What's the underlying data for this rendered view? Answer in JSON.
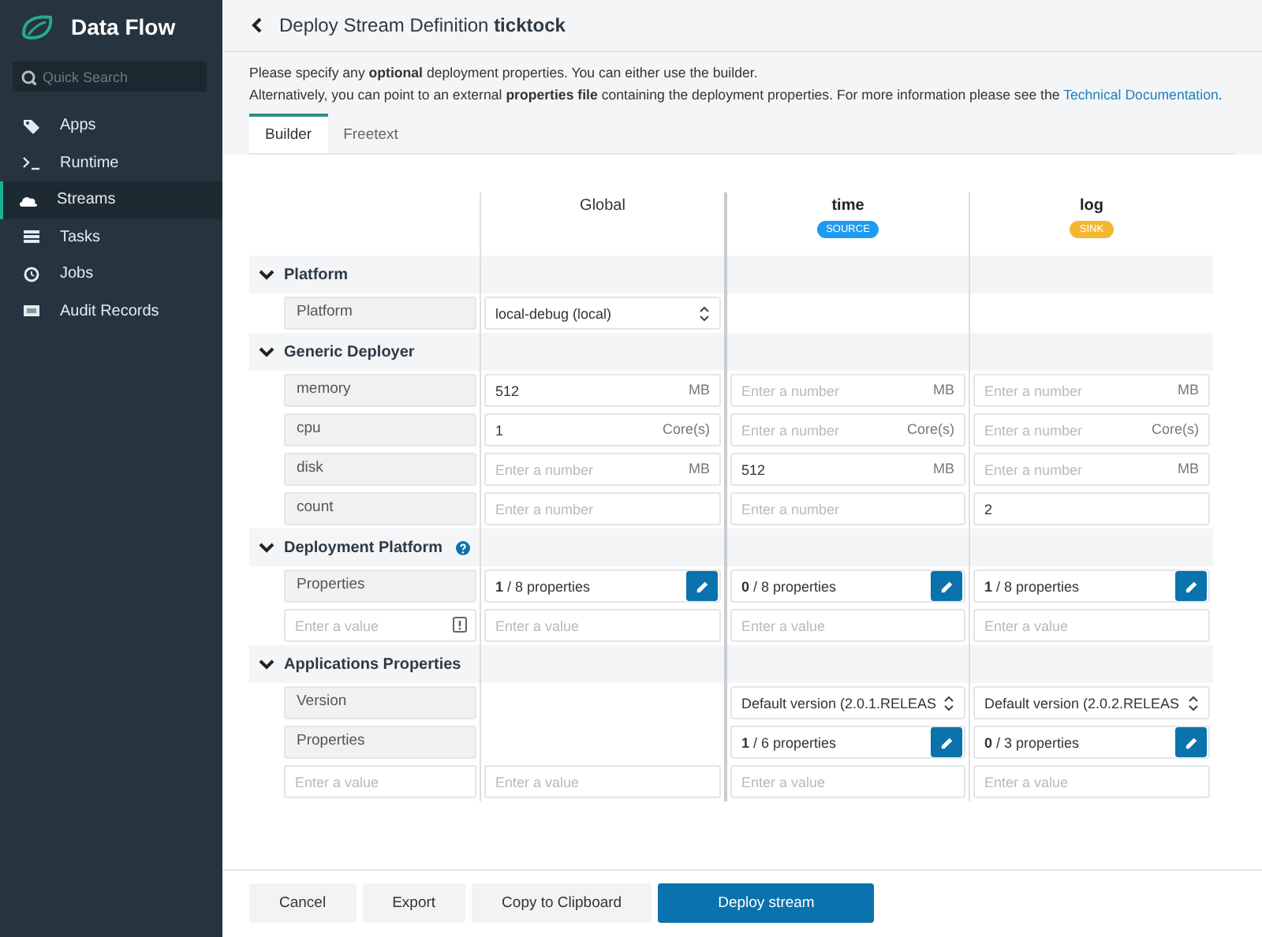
{
  "sidebar": {
    "title": "Data Flow",
    "search": {
      "placeholder": "Quick Search"
    },
    "items": [
      {
        "label": "Apps",
        "selected": false
      },
      {
        "label": "Runtime",
        "selected": false
      },
      {
        "label": "Streams",
        "selected": true
      },
      {
        "label": "Tasks",
        "selected": false
      },
      {
        "label": "Jobs",
        "selected": false
      },
      {
        "label": "Audit Records",
        "selected": false
      }
    ]
  },
  "header": {
    "title": "Deploy Stream Definition **ticktock**"
  },
  "intro": {
    "line_1": "Please specify any **optional** deployment properties. You can either use the builder.",
    "line_2": "Alternatively, you can point to an external **properties file** containing the deployment properties. For more information please see the ",
    "link": "Technical Documentation",
    "line_2_end": "."
  },
  "tabs": [
    {
      "label": "Builder",
      "selected": true
    },
    {
      "label": "Freetext",
      "selected": false
    }
  ],
  "table": {
    "columns": [
      {
        "name": "Global",
        "kind": "global"
      },
      {
        "name": "time",
        "kind": "app",
        "badge": "SOURCE",
        "color": "#1e9bf0"
      },
      {
        "name": "log",
        "kind": "app",
        "badge": "SINK",
        "color": "#f5b731"
      }
    ],
    "sections": [
      {
        "title": "Platform",
        "expanded": true,
        "help": false,
        "rows": [
          {
            "label": "Platform",
            "cells": [
              {
                "kind": "select",
                "value": "local-debug (local)"
              },
              {
                "kind": "blank"
              },
              {
                "kind": "blank"
              }
            ]
          }
        ]
      },
      {
        "title": "Generic Deployer",
        "expanded": true,
        "help": false,
        "rows": [
          {
            "label": "memory",
            "cells": [
              {
                "kind": "number",
                "value": "512",
                "unit": "MB"
              },
              {
                "kind": "number",
                "placeholder": "Enter a number",
                "unit": "MB"
              },
              {
                "kind": "number",
                "placeholder": "Enter a number",
                "unit": "MB"
              }
            ]
          },
          {
            "label": "cpu",
            "cells": [
              {
                "kind": "number",
                "value": "1",
                "unit": "Core(s)"
              },
              {
                "kind": "number",
                "placeholder": "Enter a number",
                "unit": "Core(s)"
              },
              {
                "kind": "number",
                "placeholder": "Enter a number",
                "unit": "Core(s)"
              }
            ]
          },
          {
            "label": "disk",
            "cells": [
              {
                "kind": "number",
                "placeholder": "Enter a number",
                "unit": "MB"
              },
              {
                "kind": "number",
                "value": "512",
                "unit": "MB"
              },
              {
                "kind": "number",
                "placeholder": "Enter a number",
                "unit": "MB"
              }
            ]
          },
          {
            "label": "count",
            "cells": [
              {
                "kind": "number",
                "placeholder": "Enter a number"
              },
              {
                "kind": "number",
                "placeholder": "Enter a number"
              },
              {
                "kind": "number",
                "value": "2"
              }
            ]
          }
        ]
      },
      {
        "title": "Deployment Platform",
        "expanded": true,
        "help": true,
        "rows": [
          {
            "label": "Properties",
            "cells": [
              {
                "kind": "properties",
                "text": "**1** / 8 properties"
              },
              {
                "kind": "properties",
                "text": "**0** / 8 properties"
              },
              {
                "kind": "properties",
                "text": "**1** / 8 properties"
              }
            ]
          },
          {
            "label_field": {
              "placeholder": "Enter a value",
              "invalid": true
            },
            "cells": [
              {
                "kind": "text",
                "placeholder": "Enter a value"
              },
              {
                "kind": "text",
                "placeholder": "Enter a value"
              },
              {
                "kind": "text",
                "placeholder": "Enter a value"
              }
            ]
          }
        ]
      },
      {
        "title": "Applications Properties",
        "expanded": true,
        "help": false,
        "rows": [
          {
            "label": "Version",
            "cells": [
              {
                "kind": "blank"
              },
              {
                "kind": "select",
                "value": "Default version (2.0.1.RELEAS"
              },
              {
                "kind": "select",
                "value": "Default version (2.0.2.RELEAS"
              }
            ]
          },
          {
            "label": "Properties",
            "cells": [
              {
                "kind": "blank"
              },
              {
                "kind": "properties",
                "text": "**1** / 6 properties"
              },
              {
                "kind": "properties",
                "text": "**0** / 3 properties"
              }
            ]
          },
          {
            "label_field": {
              "placeholder": "Enter a value",
              "invalid": false
            },
            "cells": [
              {
                "kind": "text",
                "placeholder": "Enter a value"
              },
              {
                "kind": "text",
                "placeholder": "Enter a value"
              },
              {
                "kind": "text",
                "placeholder": "Enter a value"
              }
            ]
          }
        ]
      }
    ]
  },
  "buttons": [
    {
      "label": "Cancel",
      "kind": "default"
    },
    {
      "label": "Export",
      "kind": "default"
    },
    {
      "label": "Copy to Clipboard",
      "kind": "default"
    },
    {
      "label": "Deploy stream",
      "kind": "primary"
    }
  ]
}
